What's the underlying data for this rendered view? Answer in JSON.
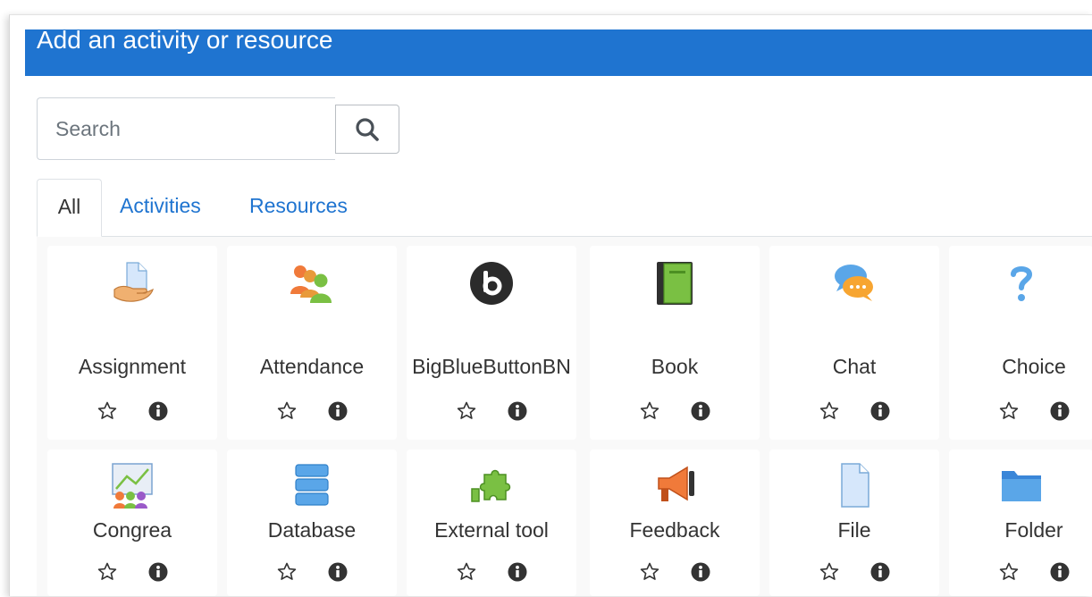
{
  "dialog": {
    "title": "Add an activity or resource"
  },
  "search": {
    "placeholder": "Search",
    "icon": "search-icon"
  },
  "tabs": [
    {
      "label": "All",
      "active": true
    },
    {
      "label": "Activities",
      "active": false
    },
    {
      "label": "Resources",
      "active": false
    }
  ],
  "colors": {
    "header": "#1f74d0",
    "link": "#1f74d0",
    "text": "#333333"
  },
  "modules": [
    {
      "name": "Assignment",
      "icon": "assignment-icon"
    },
    {
      "name": "Attendance",
      "icon": "attendance-icon"
    },
    {
      "name": "BigBlueButtonBN",
      "icon": "bigbluebutton-icon"
    },
    {
      "name": "Book",
      "icon": "book-icon"
    },
    {
      "name": "Chat",
      "icon": "chat-icon"
    },
    {
      "name": "Choice",
      "icon": "choice-icon"
    },
    {
      "name": "Congrea",
      "icon": "congrea-icon"
    },
    {
      "name": "Database",
      "icon": "database-icon"
    },
    {
      "name": "External tool",
      "icon": "external-tool-icon"
    },
    {
      "name": "Feedback",
      "icon": "feedback-icon"
    },
    {
      "name": "File",
      "icon": "file-icon"
    },
    {
      "name": "Folder",
      "icon": "folder-icon"
    }
  ],
  "tile_actions": {
    "star_icon": "star-icon",
    "info_icon": "info-icon"
  }
}
